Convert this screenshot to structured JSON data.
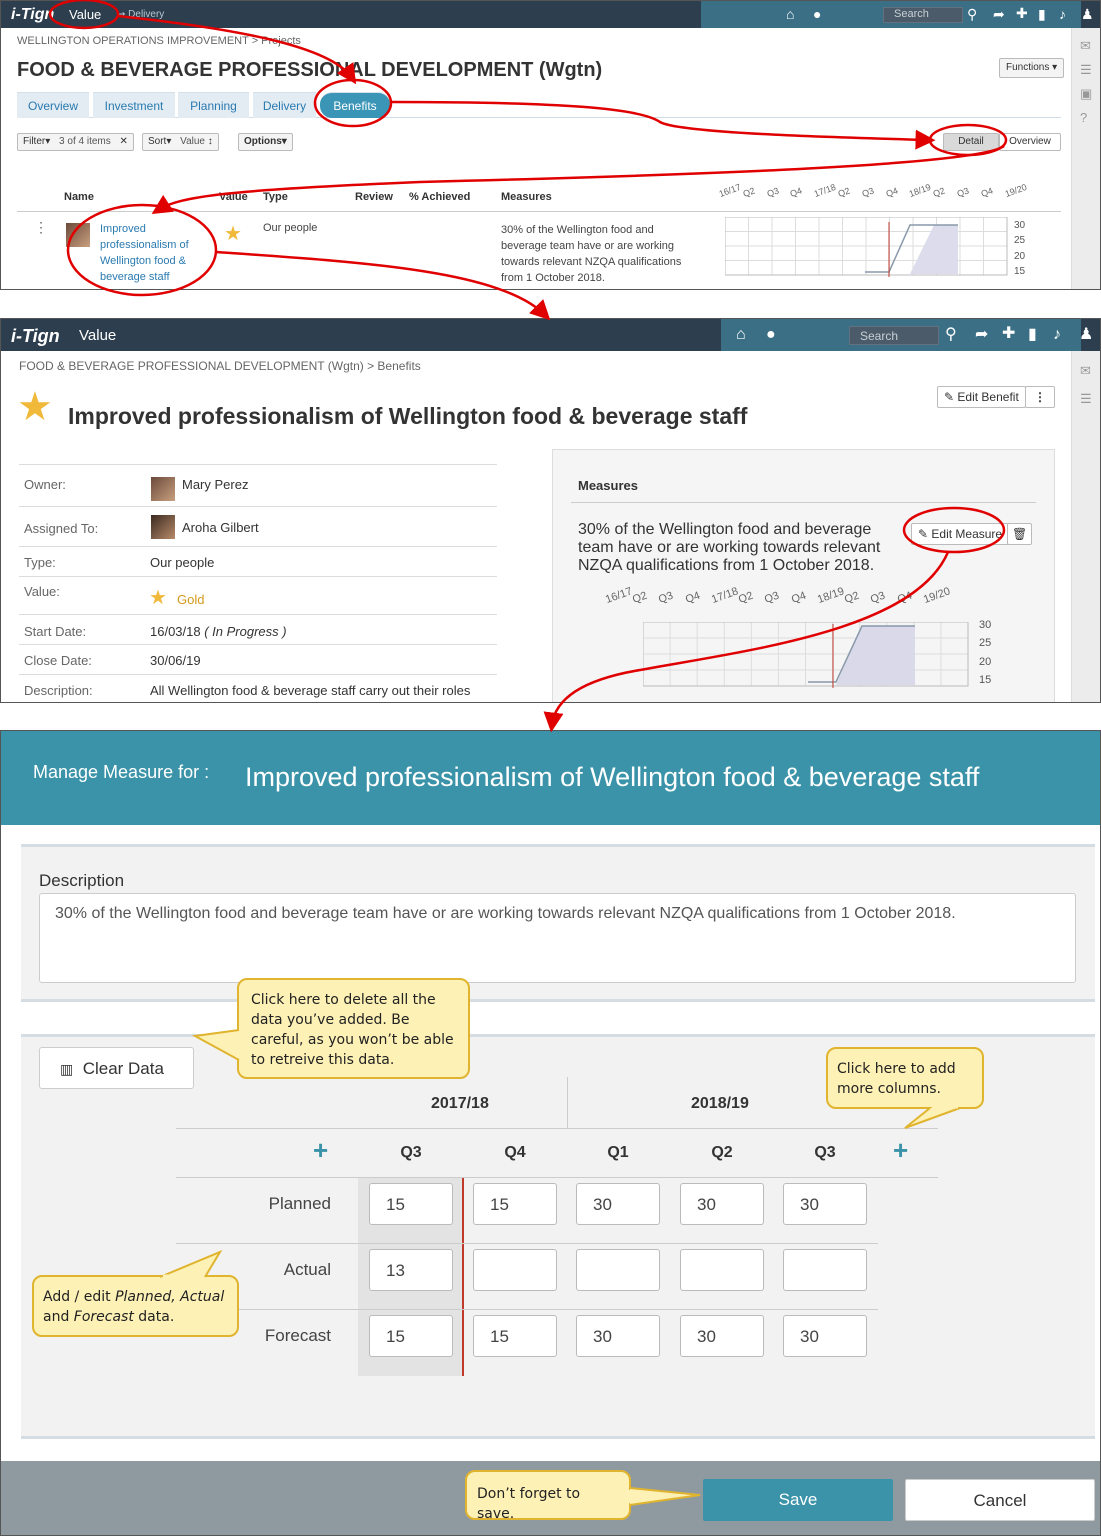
{
  "brand": "i-Tign",
  "screen1": {
    "app_label": "Value",
    "sub_label": "Delivery",
    "search_placeholder": "Search",
    "breadcrumb": "WELLINGTON OPERATIONS IMPROVEMENT > Projects",
    "title": "FOOD & BEVERAGE PROFESSIONAL DEVELOPMENT (Wgtn)",
    "functions_label": "Functions",
    "tabs": [
      "Overview",
      "Investment",
      "Planning",
      "Delivery",
      "Benefits"
    ],
    "filter_label": "Filter",
    "filter_count": "3 of 4 items",
    "sort_label": "Sort",
    "sort_value": "Value",
    "options_label": "Options",
    "detail_label": "Detail",
    "overview_label": "Overview",
    "columns": [
      "Name",
      "Value",
      "Type",
      "Review",
      "% Achieved",
      "Measures"
    ],
    "quarters": [
      "16/17",
      "Q2",
      "Q3",
      "Q4",
      "17/18",
      "Q2",
      "Q3",
      "Q4",
      "18/19",
      "Q2",
      "Q3",
      "Q4",
      "19/20"
    ],
    "y_ticks": [
      "30",
      "25",
      "20",
      "15"
    ],
    "row": {
      "name": "Improved professionalism of Wellington food & beverage staff",
      "type": "Our people",
      "measure": "30% of the Wellington food and beverage team have or are working towards relevant NZQA qualifications from 1 October 2018."
    }
  },
  "screen2": {
    "app_label": "Value",
    "search_placeholder": "Search",
    "breadcrumb": "FOOD & BEVERAGE PROFESSIONAL DEVELOPMENT (Wgtn) > Benefits",
    "title": "Improved professionalism of Wellington food & beverage staff",
    "edit_benefit": "Edit Benefit",
    "fields": [
      {
        "label": "Owner:",
        "value": "Mary Perez"
      },
      {
        "label": "Assigned To:",
        "value": "Aroha Gilbert"
      },
      {
        "label": "Type:",
        "value": "Our people"
      },
      {
        "label": "Value:",
        "value": "Gold"
      },
      {
        "label": "Start Date:",
        "value": "16/03/18",
        "status": "( In Progress )"
      },
      {
        "label": "Close Date:",
        "value": "30/06/19"
      },
      {
        "label": "Description:",
        "value": "All Wellington food & beverage staff carry out their roles"
      }
    ],
    "measures_title": "Measures",
    "measure_text": "30% of the Wellington food and beverage team have or are working towards relevant NZQA qualifications from 1 October 2018.",
    "edit_measure": "Edit Measure",
    "quarters": [
      "16/17",
      "Q2",
      "Q3",
      "Q4",
      "17/18",
      "Q2",
      "Q3",
      "Q4",
      "18/19",
      "Q2",
      "Q3",
      "Q4",
      "19/20"
    ],
    "y_ticks": [
      "30",
      "25",
      "20",
      "15"
    ]
  },
  "modal": {
    "prefix": "Manage Measure for :",
    "title": "Improved professionalism of Wellington food & beverage staff",
    "description_label": "Description",
    "description": "30% of the Wellington food and beverage team have or are working towards relevant NZQA qualifications from 1 October 2018.",
    "clear_data": "Clear Data",
    "years": [
      "2017/18",
      "2018/19"
    ],
    "quarters": [
      "Q3",
      "Q4",
      "Q1",
      "Q2",
      "Q3"
    ],
    "rows": [
      {
        "label": "Planned",
        "values": [
          "15",
          "15",
          "30",
          "30",
          "30"
        ]
      },
      {
        "label": "Actual",
        "values": [
          "13",
          "",
          "",
          "",
          ""
        ]
      },
      {
        "label": "Forecast",
        "values": [
          "15",
          "15",
          "30",
          "30",
          "30"
        ]
      }
    ],
    "save": "Save",
    "cancel": "Cancel"
  },
  "callouts": {
    "clear": "Click here to delete all the data you’ve added. Be careful, as you won’t be able to retreive this data.",
    "add_columns": "Click here to add more columns.",
    "edit_pre": "Add / edit ",
    "edit_em1": "Planned, Actual",
    "edit_mid": " and ",
    "edit_em2": "Forecast",
    "edit_post": " data.",
    "save": "Don’t forget to save."
  },
  "colors": {
    "topbar": "#2d3e4e",
    "accent": "#3a95b7",
    "modal_header": "#3a93a8",
    "annotation": "#e00000",
    "callout_bg": "#fdf1b6"
  },
  "chart_data": {
    "type": "line",
    "series": [
      {
        "name": "Planned",
        "values": [
          15,
          15,
          30,
          30,
          30
        ]
      },
      {
        "name": "Actual",
        "values": [
          13
        ]
      }
    ],
    "ylim": [
      15,
      30
    ]
  }
}
